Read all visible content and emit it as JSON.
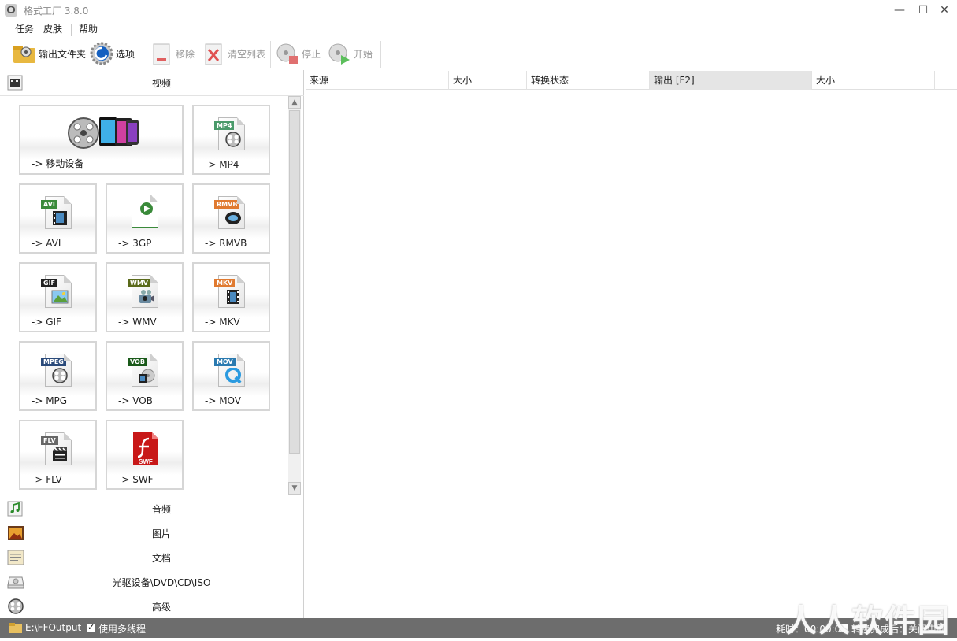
{
  "window": {
    "title": "格式工厂 3.8.0",
    "minimize": "—",
    "maximize": "☐",
    "close": "✕"
  },
  "menu": [
    "任务",
    "皮肤",
    "帮助"
  ],
  "toolbar": {
    "output_folder": "输出文件夹",
    "options": "选项",
    "remove": "移除",
    "clear_list": "清空列表",
    "stop": "停止",
    "start": "开始"
  },
  "categories": {
    "video": "视频",
    "audio": "音频",
    "image": "图片",
    "document": "文档",
    "rom": "光驱设备\\DVD\\CD\\ISO",
    "advanced": "高级"
  },
  "tiles": [
    {
      "label": "-> 移动设备",
      "tag": "",
      "tag_color": ""
    },
    {
      "label": "-> MP4",
      "tag": "MP4",
      "tag_color": "#4a9a6a"
    },
    {
      "label": "-> AVI",
      "tag": "AVI",
      "tag_color": "#3a8a3a"
    },
    {
      "label": "-> 3GP",
      "tag": "",
      "tag_color": ""
    },
    {
      "label": "-> RMVB",
      "tag": "RMVB",
      "tag_color": "#e07a30"
    },
    {
      "label": "-> GIF",
      "tag": "GIF",
      "tag_color": "#222222"
    },
    {
      "label": "-> WMV",
      "tag": "WMV",
      "tag_color": "#5a6a1a"
    },
    {
      "label": "-> MKV",
      "tag": "MKV",
      "tag_color": "#e07a30"
    },
    {
      "label": "-> MPG",
      "tag": "MPEG",
      "tag_color": "#2a4a7a"
    },
    {
      "label": "-> VOB",
      "tag": "VOB",
      "tag_color": "#1a5a1a"
    },
    {
      "label": "-> MOV",
      "tag": "MOV",
      "tag_color": "#2a7ab0"
    },
    {
      "label": "-> FLV",
      "tag": "FLV",
      "tag_color": "#666666"
    },
    {
      "label": "-> SWF",
      "tag": "SWF",
      "tag_color": "#c01818"
    }
  ],
  "columns": [
    "来源",
    "大小",
    "转换状态",
    "输出 [F2]",
    "大小"
  ],
  "status": {
    "output_path": "E:\\FFOutput",
    "multithread": "使用多线程",
    "elapsed": "耗时：00:00:00",
    "shutdown": "转换完成后：关闭电脑"
  },
  "watermark": "人人软件园",
  "colors": {
    "status_bar": "#6d6d6d",
    "selected_column": "#e5e5e5"
  }
}
